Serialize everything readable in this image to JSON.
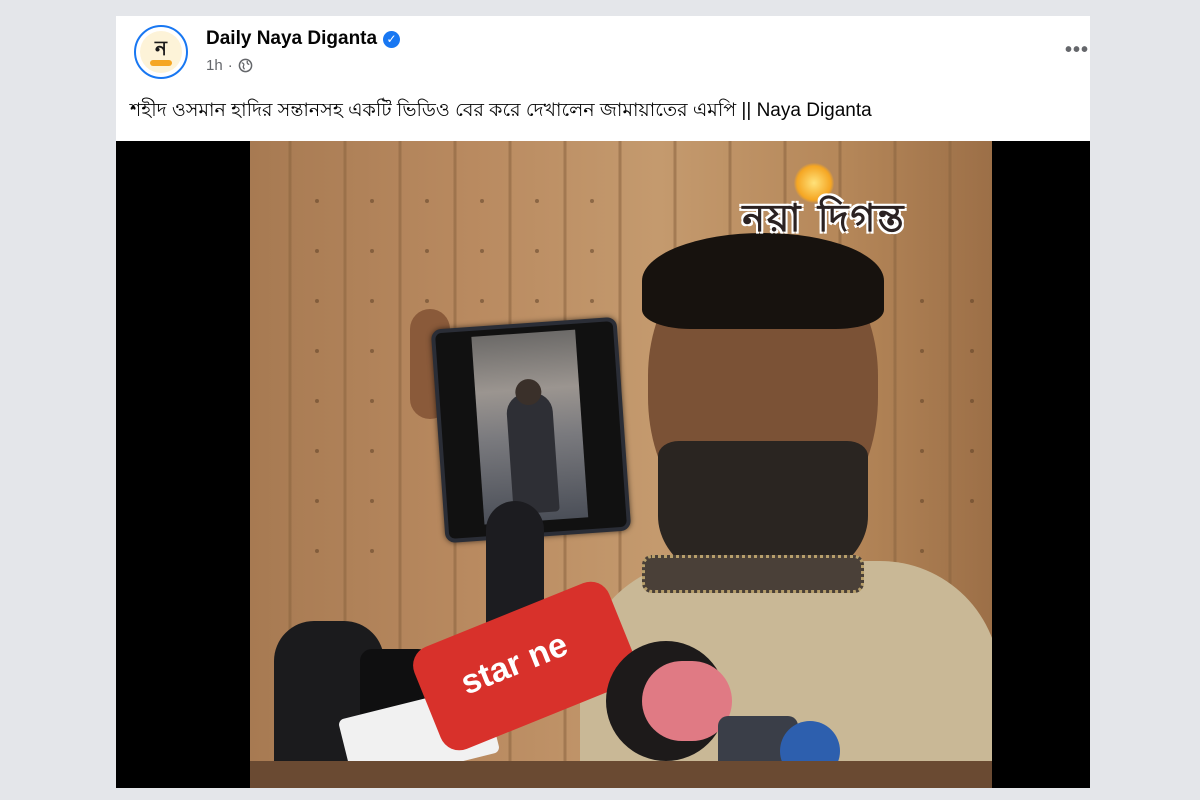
{
  "post": {
    "page_name": "Daily Naya Diganta",
    "verified": true,
    "time": "1h",
    "separator": "·",
    "privacy_icon": "globe-icon",
    "more_icon": "more-options-icon",
    "more_label": "•••",
    "text": "শহীদ ওসমান হাদির সন্তানসহ একটি ভিডিও বের করে দেখালেন জামায়াতের এমপি || Naya Diganta",
    "avatar_glyph": "ন"
  },
  "video": {
    "watermark_text": "নয়া দিগন্ত",
    "mic_label": "star ne"
  },
  "colors": {
    "page_background": "#e4e6ea",
    "card_background": "#ffffff",
    "brand_blue": "#1877f2",
    "secondary_text": "#65676b",
    "video_background": "#000000"
  }
}
